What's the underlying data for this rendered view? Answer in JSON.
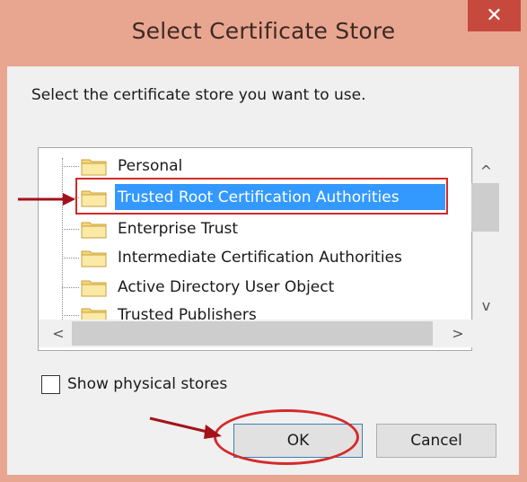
{
  "window": {
    "title": "Select Certificate Store",
    "close_glyph": "✕"
  },
  "dialog": {
    "prompt": "Select the certificate store you want to use.",
    "stores": [
      {
        "label": "Personal",
        "selected": false
      },
      {
        "label": "Trusted Root Certification Authorities",
        "selected": true
      },
      {
        "label": "Enterprise Trust",
        "selected": false
      },
      {
        "label": "Intermediate Certification Authorities",
        "selected": false
      },
      {
        "label": "Active Directory User Object",
        "selected": false
      },
      {
        "label": "Trusted Publishers",
        "selected": false
      }
    ],
    "scroll_up_glyph": "^",
    "scroll_down_glyph": "v",
    "scroll_left_glyph": "<",
    "scroll_right_glyph": ">",
    "show_physical_label": "Show physical stores",
    "show_physical_checked": false,
    "ok_label": "OK",
    "cancel_label": "Cancel"
  },
  "colors": {
    "title_bar": "#e8a690",
    "close_button": "#c7493d",
    "selection": "#3399ff",
    "annotation": "#d42a2a"
  },
  "icons": {
    "store": "folder-icon",
    "pointer": "red-arrow-icon"
  }
}
